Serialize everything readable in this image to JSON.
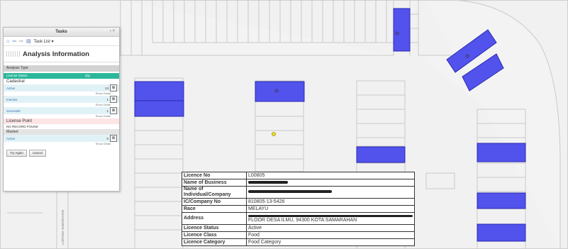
{
  "tasks_panel": {
    "title": "Tasks",
    "window_controls": "‹ ×",
    "toolbar_label": "Task List",
    "heading": "Analysis Information",
    "analysis_type_label": "Analysis Type",
    "col_status": "License Status",
    "col_qty": "Qty",
    "cadastral_label": "Cadastral",
    "cadastral_rows": [
      {
        "status": "Active",
        "qty": "13",
        "show": "Show Detail"
      },
      {
        "status": "Inactive",
        "qty": "1",
        "show": "Show Detail"
      },
      {
        "status": "Surrender",
        "qty": "1",
        "show": "Show Detail"
      }
    ],
    "license_point_label": "License Point",
    "no_record": "NO RECORD FOUND",
    "market_label": "Market",
    "market_rows": [
      {
        "status": "Active",
        "qty": "0",
        "show": "Show Detail"
      }
    ],
    "try_again": "Try Again",
    "cancel": "Cancel"
  },
  "attribute_table": {
    "rows": [
      {
        "key": "Licence No",
        "value": "L00805"
      },
      {
        "key": "Name of Business",
        "value": ""
      },
      {
        "key": "Name of Individual/Company",
        "value": ""
      },
      {
        "key": "IC/Company No",
        "value": "810805-13-5426"
      },
      {
        "key": "Race",
        "value": "MELAYU"
      },
      {
        "key": "Address",
        "value": "FLOOR DESA ILMU, 94300 KOTA SAMARAHAN"
      },
      {
        "key": "Licence Status",
        "value": "Active"
      },
      {
        "key": "Licence Class",
        "value": "Food"
      },
      {
        "key": "Licence Category",
        "value": "Food Category"
      }
    ]
  },
  "map": {
    "highlight_color": "#5050ee",
    "point_color": "#f0e020",
    "road_label": "LORONG SAMARAHAN"
  }
}
